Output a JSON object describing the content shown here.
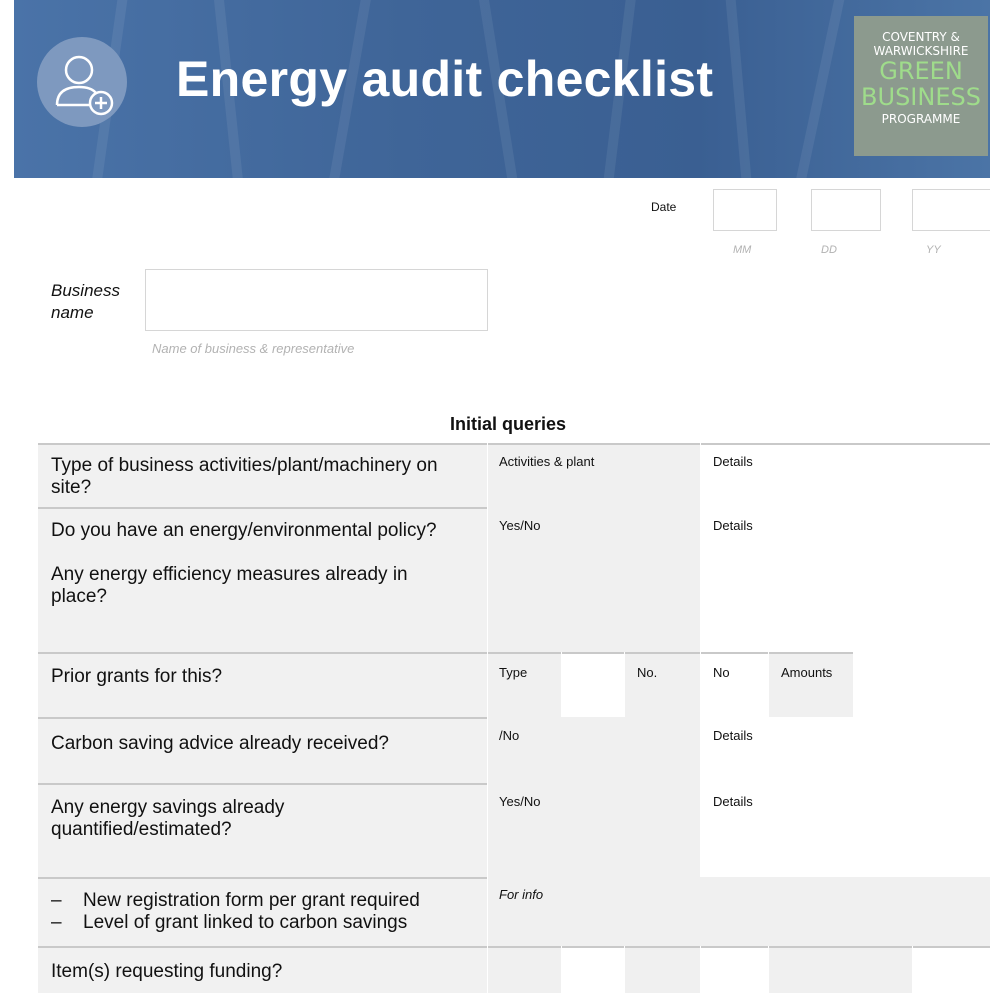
{
  "header": {
    "title": "Energy audit checklist",
    "logo": {
      "line1": "COVENTRY &",
      "line2": "WARWICKSHIRE",
      "line3": "GREEN",
      "line4": "BUSINESS",
      "line5": "PROGRAMME"
    }
  },
  "date": {
    "label": "Date",
    "mm": "MM",
    "dd": "DD",
    "yy": "YY"
  },
  "business": {
    "label_line1": "Business",
    "label_line2": "name",
    "hint": "Name of business & representative"
  },
  "section_title": "Initial queries",
  "rows": {
    "r1": {
      "q": "Type of business activities/plant/machinery on site?",
      "a": "Activities & plant",
      "b": "Details"
    },
    "r2": {
      "q1": "Do you have an energy/environmental policy?",
      "q2": "Any energy efficiency measures already in place?",
      "a": "Yes/No",
      "b": "Details"
    },
    "r3": {
      "q": "Prior grants for this?",
      "type": "Type",
      "no": "No.",
      "no2": "No",
      "amounts": "Amounts"
    },
    "r4": {
      "q": "Carbon saving advice already received?",
      "a": "/No",
      "b": "Details"
    },
    "r5": {
      "q": "Any energy savings already quantified/estimated?",
      "a": "Yes/No",
      "b": "Details"
    },
    "r6": {
      "bullet1": "New registration form per grant required",
      "bullet2": "Level of grant linked to carbon savings",
      "bullet_mark": "–",
      "a": "For info"
    },
    "r7": {
      "q": "Item(s) requesting funding?"
    }
  },
  "colors": {
    "header_blue": "#3f6598",
    "logo_green": "#9fdc8b",
    "cell_grey": "#f0f0f0"
  }
}
